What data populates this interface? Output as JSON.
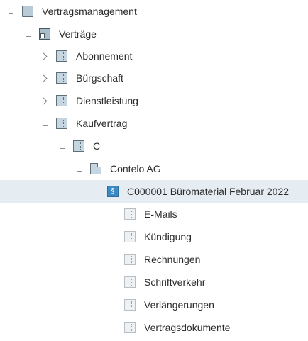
{
  "tree": {
    "selected_index": 7,
    "nodes": [
      {
        "label": "Vertragsmanagement",
        "level": 0,
        "state": "expanded",
        "icon": "cabinet-icon"
      },
      {
        "label": "Verträge",
        "level": 1,
        "state": "expanded",
        "icon": "register-icon"
      },
      {
        "label": "Abonnement",
        "level": 2,
        "state": "collapsed",
        "icon": "folder-icon"
      },
      {
        "label": "Bürgschaft",
        "level": 2,
        "state": "collapsed",
        "icon": "folder-icon"
      },
      {
        "label": "Dienstleistung",
        "level": 2,
        "state": "collapsed",
        "icon": "folder-icon"
      },
      {
        "label": "Kaufvertrag",
        "level": 2,
        "state": "expanded",
        "icon": "folder-icon"
      },
      {
        "label": "C",
        "level": 3,
        "state": "expanded",
        "icon": "folder-icon"
      },
      {
        "label": "Contelo AG",
        "level": 4,
        "state": "expanded",
        "icon": "document-folder-icon"
      },
      {
        "label": "C000001 Büromaterial Februar 2022",
        "level": 5,
        "state": "expanded",
        "icon": "contract-icon",
        "icon_glyph": "§"
      },
      {
        "label": "E-Mails",
        "level": 6,
        "state": "leaf",
        "icon": "sub-register-icon"
      },
      {
        "label": "Kündigung",
        "level": 6,
        "state": "leaf",
        "icon": "sub-register-icon"
      },
      {
        "label": "Rechnungen",
        "level": 6,
        "state": "leaf",
        "icon": "sub-register-icon"
      },
      {
        "label": "Schriftverkehr",
        "level": 6,
        "state": "leaf",
        "icon": "sub-register-icon"
      },
      {
        "label": "Verlängerungen",
        "level": 6,
        "state": "leaf",
        "icon": "sub-register-icon"
      },
      {
        "label": "Vertragsdokumente",
        "level": 6,
        "state": "leaf",
        "icon": "sub-register-icon"
      }
    ]
  }
}
